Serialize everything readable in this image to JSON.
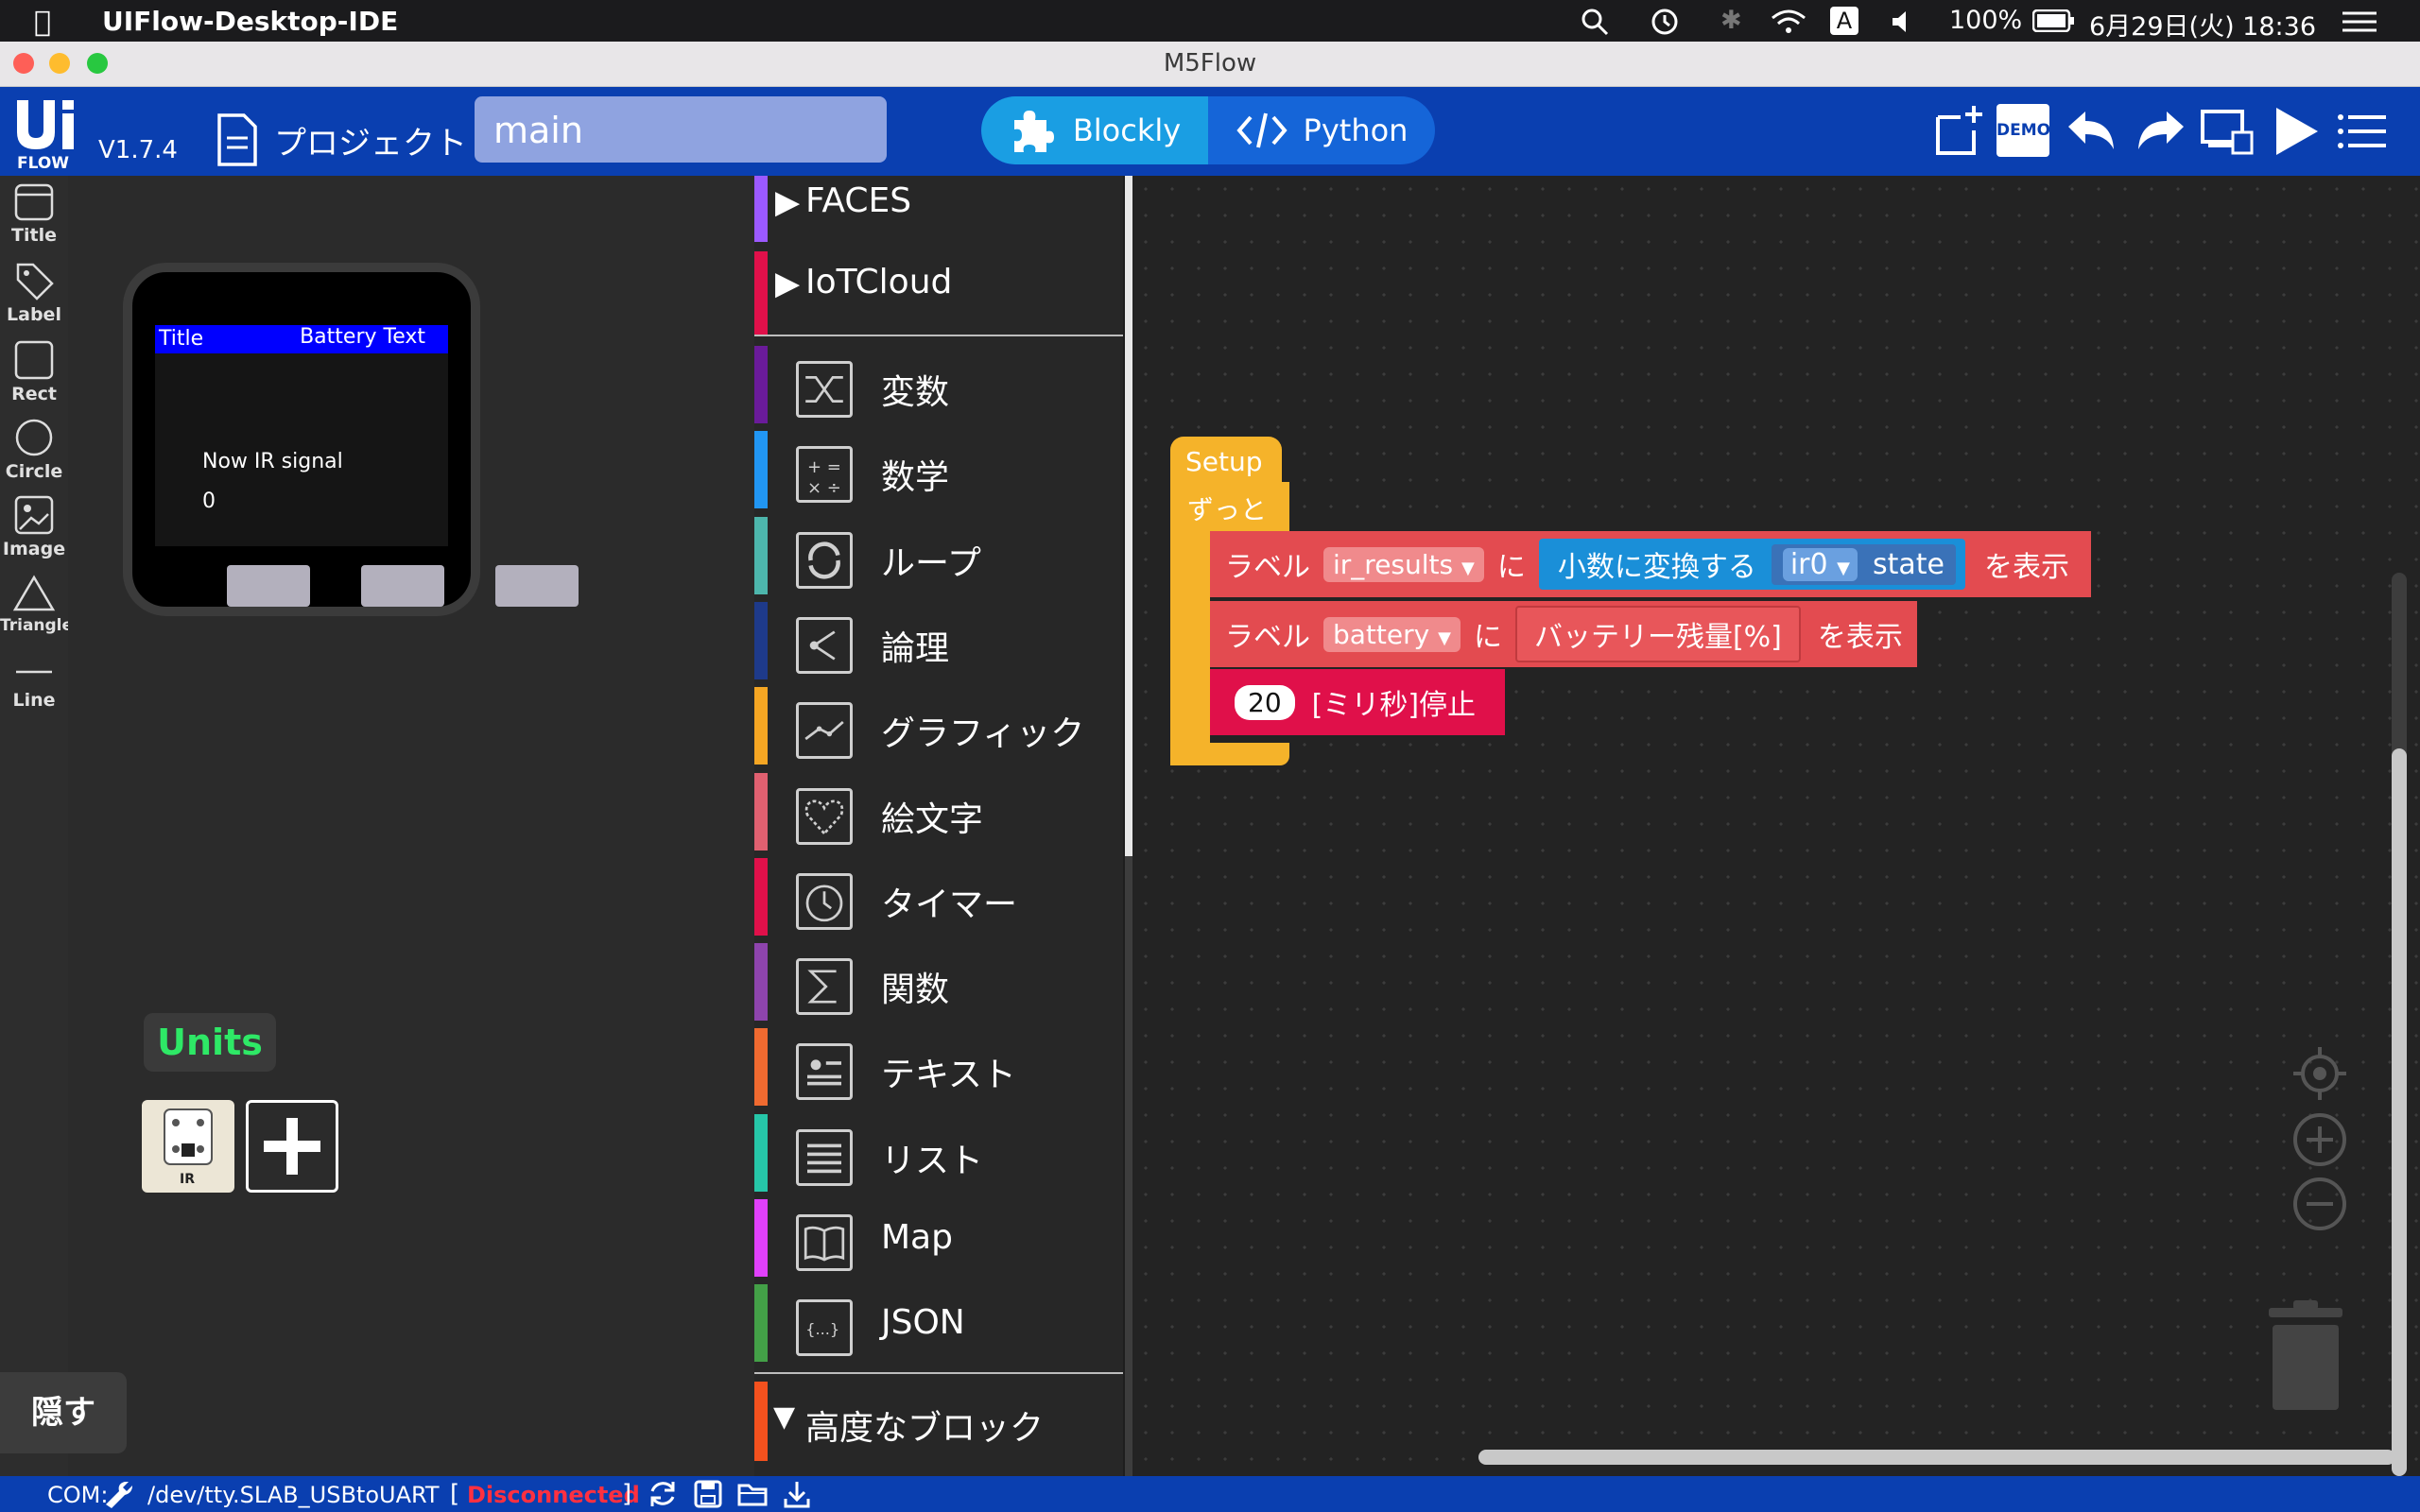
{
  "menubar": {
    "app_name": "UIFlow-Desktop-IDE",
    "battery": "100%",
    "datetime": "6月29日(火)  18:36",
    "input_indicator": "A"
  },
  "window": {
    "title": "M5Flow"
  },
  "header": {
    "logo_text": "FLOW",
    "version": "V1.7.4",
    "project_label": "プロジェクト",
    "file_name": "main",
    "blockly_label": "Blockly",
    "python_label": "Python",
    "demo_label": "DEMO"
  },
  "tools": [
    {
      "label": "Title",
      "icon": "title-icon"
    },
    {
      "label": "Label",
      "icon": "label-tag-icon"
    },
    {
      "label": "Rect",
      "icon": "rect-icon"
    },
    {
      "label": "Circle",
      "icon": "circle-icon"
    },
    {
      "label": "Image",
      "icon": "image-icon"
    },
    {
      "label": "Triangle",
      "icon": "triangle-icon"
    },
    {
      "label": "Line",
      "icon": "line-icon"
    }
  ],
  "device": {
    "title_text": "Title",
    "battery_text": "Battery Text",
    "ir_label": "Now IR signal",
    "ir_value": "0"
  },
  "units": {
    "heading": "Units",
    "unit_ir_label": "IR"
  },
  "hide_label": "隠す",
  "categories": {
    "faces": "FACES",
    "iotcloud": "IoTCloud",
    "items": [
      {
        "label": "変数",
        "color": "#6a1b9a",
        "icon": "shuffle-icon"
      },
      {
        "label": "数学",
        "color": "#2196f3",
        "icon": "math-icon"
      },
      {
        "label": "ループ",
        "color": "#4db6ac",
        "icon": "loop-icon"
      },
      {
        "label": "論理",
        "color": "#1e3a8a",
        "icon": "logic-icon"
      },
      {
        "label": "グラフィック",
        "color": "#f5a623",
        "icon": "graph-icon"
      },
      {
        "label": "絵文字",
        "color": "#e06070",
        "icon": "heart-icon"
      },
      {
        "label": "タイマー",
        "color": "#e0104a",
        "icon": "timer-icon"
      },
      {
        "label": "関数",
        "color": "#8e44ad",
        "icon": "sigma-icon"
      },
      {
        "label": "テキスト",
        "color": "#f06a30",
        "icon": "text-card-icon"
      },
      {
        "label": "リスト",
        "color": "#26c6a8",
        "icon": "list-icon"
      },
      {
        "label": "Map",
        "color": "#e040fb",
        "icon": "book-icon"
      },
      {
        "label": "JSON",
        "color": "#43a047",
        "icon": "json-icon"
      }
    ],
    "advanced": "高度なブロック"
  },
  "blocks": {
    "setup": "Setup",
    "loop": "ずっと",
    "label_word": "ラベル",
    "ni": "に",
    "show": "を表示",
    "var1": "ir_results",
    "convert": "小数に変換する",
    "ir_var": "ir0",
    "state": "state",
    "var2": "battery",
    "battery_text": "バッテリー残量[%]",
    "wait_value": "20",
    "wait_label": "[ミリ秒]停止"
  },
  "status": {
    "com_label": "COM:",
    "port": "/dev/tty.SLAB_USBtoUART",
    "connection": "Disconnected"
  },
  "colors": {
    "header": "#0a3fb0",
    "block_red": "#e34b50",
    "block_yellow": "#f5b32a",
    "block_blue": "#1a8fd8",
    "disconnected": "#ff3040",
    "units_green": "#2ee866"
  }
}
